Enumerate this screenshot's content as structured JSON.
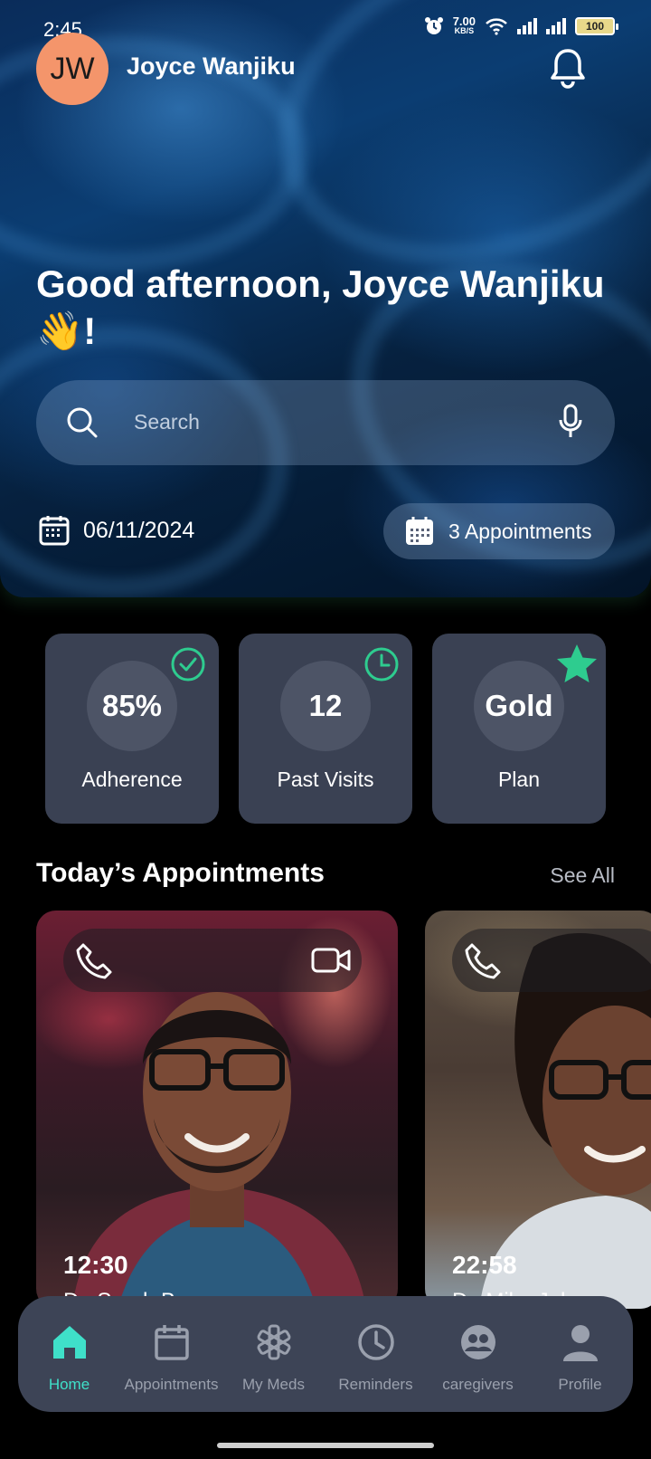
{
  "status_bar": {
    "time": "2:45",
    "net_speed": "7.00",
    "net_unit": "KB/S",
    "battery": "100"
  },
  "header": {
    "avatar_initials": "JW",
    "user_name": "Joyce Wanjiku",
    "avatar_color": "#f4956b"
  },
  "greeting": {
    "text": "Good afternoon, Joyce Wanjiku",
    "emoji": "👋!"
  },
  "search": {
    "placeholder": "Search"
  },
  "summary": {
    "date": "06/11/2024",
    "appointments": "3 Appointments"
  },
  "stats": [
    {
      "value": "85%",
      "label": "Adherence",
      "badge_icon": "check-circle-icon"
    },
    {
      "value": "12",
      "label": "Past Visits",
      "badge_icon": "clock-icon"
    },
    {
      "value": "Gold",
      "label": "Plan",
      "badge_icon": "star-icon"
    }
  ],
  "appointments_section": {
    "title": "Today’s Appointments",
    "see_all": "See All"
  },
  "appointment_cards": [
    {
      "time": "12:30",
      "name": "Dr. Sarah B..."
    },
    {
      "time": "22:58",
      "name": "Dr. Mike Johnso..."
    }
  ],
  "nav": {
    "items": [
      {
        "label": "Home",
        "icon": "home-icon",
        "active": true
      },
      {
        "label": "Appointments",
        "icon": "calendar-icon",
        "active": false
      },
      {
        "label": "My Meds",
        "icon": "medical-star-icon",
        "active": false
      },
      {
        "label": "Reminders",
        "icon": "clock-icon",
        "active": false
      },
      {
        "label": "caregivers",
        "icon": "people-icon",
        "active": false
      },
      {
        "label": "Profile",
        "icon": "person-icon",
        "active": false
      }
    ]
  },
  "colors": {
    "accent": "#3fe0c9",
    "badge_green": "#2ecc8f",
    "card_bg": "#3a4153",
    "nav_bg": "#3d4456"
  }
}
